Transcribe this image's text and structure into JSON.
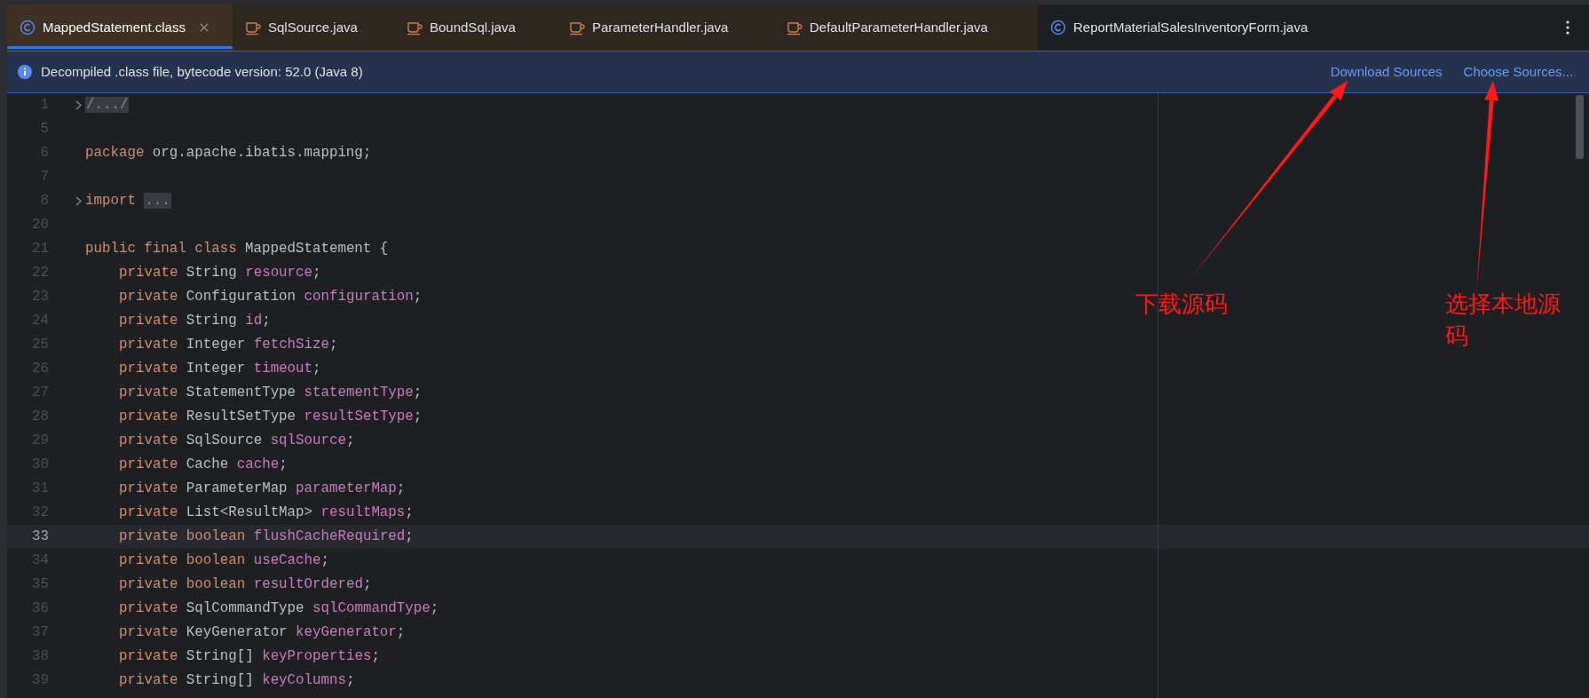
{
  "tabs": [
    {
      "label": "MappedStatement.class",
      "kind": "class",
      "selected": true,
      "tinted": true
    },
    {
      "label": "SqlSource.java",
      "kind": "java",
      "selected": false,
      "tinted": true
    },
    {
      "label": "BoundSql.java",
      "kind": "java",
      "selected": false,
      "tinted": true
    },
    {
      "label": "ParameterHandler.java",
      "kind": "java",
      "selected": false,
      "tinted": true
    },
    {
      "label": "DefaultParameterHandler.java",
      "kind": "java",
      "selected": false,
      "tinted": true
    },
    {
      "label": "ReportMaterialSalesInventoryForm.java",
      "kind": "class",
      "selected": false,
      "tinted": false
    }
  ],
  "notification": {
    "message": "Decompiled .class file, bytecode version: 52.0 (Java 8)",
    "links": [
      "Download Sources",
      "Choose Sources..."
    ]
  },
  "editor": {
    "lines": [
      {
        "number": "1",
        "kind": "top",
        "foldable": true,
        "current": false,
        "tokens": [
          {
            "kind": "folded",
            "text": "/.../"
          }
        ]
      },
      {
        "number": "5",
        "foldable": false,
        "current": false
      },
      {
        "number": "6",
        "kind": "top",
        "foldable": false,
        "current": false,
        "tokens": [
          {
            "kind": "keyword",
            "text": "package"
          },
          {
            "kind": "plain",
            "text": " org.apache.ibatis.mapping;"
          }
        ]
      },
      {
        "number": "7",
        "foldable": false,
        "current": false
      },
      {
        "number": "8",
        "kind": "top",
        "foldable": true,
        "current": false,
        "tokens": [
          {
            "kind": "keyword",
            "text": "import"
          },
          {
            "kind": "folded",
            "text": "..."
          }
        ]
      },
      {
        "number": "20",
        "foldable": false,
        "current": false
      },
      {
        "number": "21",
        "kind": "top",
        "foldable": false,
        "current": false,
        "tokens": [
          {
            "kind": "keyword",
            "text": "public final class"
          },
          {
            "kind": "plain",
            "text": " MappedStatement {"
          }
        ]
      },
      {
        "number": "22",
        "kind": "member",
        "foldable": false,
        "current": false,
        "tokens": [
          {
            "kind": "keyword",
            "text": "private"
          },
          {
            "kind": "plain",
            "text": " String "
          },
          {
            "kind": "field",
            "text": "resource"
          },
          {
            "kind": "plain",
            "text": ";"
          }
        ]
      },
      {
        "number": "23",
        "kind": "member",
        "foldable": false,
        "current": false,
        "tokens": [
          {
            "kind": "keyword",
            "text": "private"
          },
          {
            "kind": "plain",
            "text": " Configuration "
          },
          {
            "kind": "field",
            "text": "configuration"
          },
          {
            "kind": "plain",
            "text": ";"
          }
        ]
      },
      {
        "number": "24",
        "kind": "member",
        "foldable": false,
        "current": false,
        "tokens": [
          {
            "kind": "keyword",
            "text": "private"
          },
          {
            "kind": "plain",
            "text": " String "
          },
          {
            "kind": "field",
            "text": "id"
          },
          {
            "kind": "plain",
            "text": ";"
          }
        ]
      },
      {
        "number": "25",
        "kind": "member",
        "foldable": false,
        "current": false,
        "tokens": [
          {
            "kind": "keyword",
            "text": "private"
          },
          {
            "kind": "plain",
            "text": " Integer "
          },
          {
            "kind": "field",
            "text": "fetchSize"
          },
          {
            "kind": "plain",
            "text": ";"
          }
        ]
      },
      {
        "number": "26",
        "kind": "member",
        "foldable": false,
        "current": false,
        "tokens": [
          {
            "kind": "keyword",
            "text": "private"
          },
          {
            "kind": "plain",
            "text": " Integer "
          },
          {
            "kind": "field",
            "text": "timeout"
          },
          {
            "kind": "plain",
            "text": ";"
          }
        ]
      },
      {
        "number": "27",
        "kind": "member",
        "foldable": false,
        "current": false,
        "tokens": [
          {
            "kind": "keyword",
            "text": "private"
          },
          {
            "kind": "plain",
            "text": " StatementType "
          },
          {
            "kind": "field",
            "text": "statementType"
          },
          {
            "kind": "plain",
            "text": ";"
          }
        ]
      },
      {
        "number": "28",
        "kind": "member",
        "foldable": false,
        "current": false,
        "tokens": [
          {
            "kind": "keyword",
            "text": "private"
          },
          {
            "kind": "plain",
            "text": " ResultSetType "
          },
          {
            "kind": "field",
            "text": "resultSetType"
          },
          {
            "kind": "plain",
            "text": ";"
          }
        ]
      },
      {
        "number": "29",
        "kind": "member",
        "foldable": false,
        "current": false,
        "tokens": [
          {
            "kind": "keyword",
            "text": "private"
          },
          {
            "kind": "plain",
            "text": " SqlSource "
          },
          {
            "kind": "field",
            "text": "sqlSource"
          },
          {
            "kind": "plain",
            "text": ";"
          }
        ]
      },
      {
        "number": "30",
        "kind": "member",
        "foldable": false,
        "current": false,
        "tokens": [
          {
            "kind": "keyword",
            "text": "private"
          },
          {
            "kind": "plain",
            "text": " Cache "
          },
          {
            "kind": "field",
            "text": "cache"
          },
          {
            "kind": "plain",
            "text": ";"
          }
        ]
      },
      {
        "number": "31",
        "kind": "member",
        "foldable": false,
        "current": false,
        "tokens": [
          {
            "kind": "keyword",
            "text": "private"
          },
          {
            "kind": "plain",
            "text": " ParameterMap "
          },
          {
            "kind": "field",
            "text": "parameterMap"
          },
          {
            "kind": "plain",
            "text": ";"
          }
        ]
      },
      {
        "number": "32",
        "kind": "member",
        "foldable": false,
        "current": false,
        "tokens": [
          {
            "kind": "keyword",
            "text": "private"
          },
          {
            "kind": "plain",
            "text": " List<ResultMap> "
          },
          {
            "kind": "field",
            "text": "resultMaps"
          },
          {
            "kind": "plain",
            "text": ";"
          }
        ]
      },
      {
        "number": "33",
        "kind": "member",
        "foldable": false,
        "current": true,
        "tokens": [
          {
            "kind": "keyword",
            "text": "private boolean"
          },
          {
            "kind": "field",
            "text": " flushCacheRequired"
          },
          {
            "kind": "plain",
            "text": ";"
          }
        ]
      },
      {
        "number": "34",
        "kind": "member",
        "foldable": false,
        "current": false,
        "tokens": [
          {
            "kind": "keyword",
            "text": "private boolean"
          },
          {
            "kind": "field",
            "text": " useCache"
          },
          {
            "kind": "plain",
            "text": ";"
          }
        ]
      },
      {
        "number": "35",
        "kind": "member",
        "foldable": false,
        "current": false,
        "tokens": [
          {
            "kind": "keyword",
            "text": "private boolean"
          },
          {
            "kind": "field",
            "text": " resultOrdered"
          },
          {
            "kind": "plain",
            "text": ";"
          }
        ]
      },
      {
        "number": "36",
        "kind": "member",
        "foldable": false,
        "current": false,
        "tokens": [
          {
            "kind": "keyword",
            "text": "private"
          },
          {
            "kind": "plain",
            "text": " SqlCommandType "
          },
          {
            "kind": "field",
            "text": "sqlCommandType"
          },
          {
            "kind": "plain",
            "text": ";"
          }
        ]
      },
      {
        "number": "37",
        "kind": "member",
        "foldable": false,
        "current": false,
        "tokens": [
          {
            "kind": "keyword",
            "text": "private"
          },
          {
            "kind": "plain",
            "text": " KeyGenerator "
          },
          {
            "kind": "field",
            "text": "keyGenerator"
          },
          {
            "kind": "plain",
            "text": ";"
          }
        ]
      },
      {
        "number": "38",
        "kind": "member",
        "foldable": false,
        "current": false,
        "tokens": [
          {
            "kind": "keyword",
            "text": "private"
          },
          {
            "kind": "plain",
            "text": " String[] "
          },
          {
            "kind": "field",
            "text": "keyProperties"
          },
          {
            "kind": "plain",
            "text": ";"
          }
        ]
      },
      {
        "number": "39",
        "kind": "member",
        "foldable": false,
        "current": false,
        "tokens": [
          {
            "kind": "keyword",
            "text": "private"
          },
          {
            "kind": "plain",
            "text": " String[] "
          },
          {
            "kind": "field",
            "text": "keyColumns"
          },
          {
            "kind": "plain",
            "text": ";"
          }
        ]
      }
    ]
  },
  "annotations": [
    {
      "text": "下载源码"
    },
    {
      "text": "选择本地源码"
    }
  ]
}
